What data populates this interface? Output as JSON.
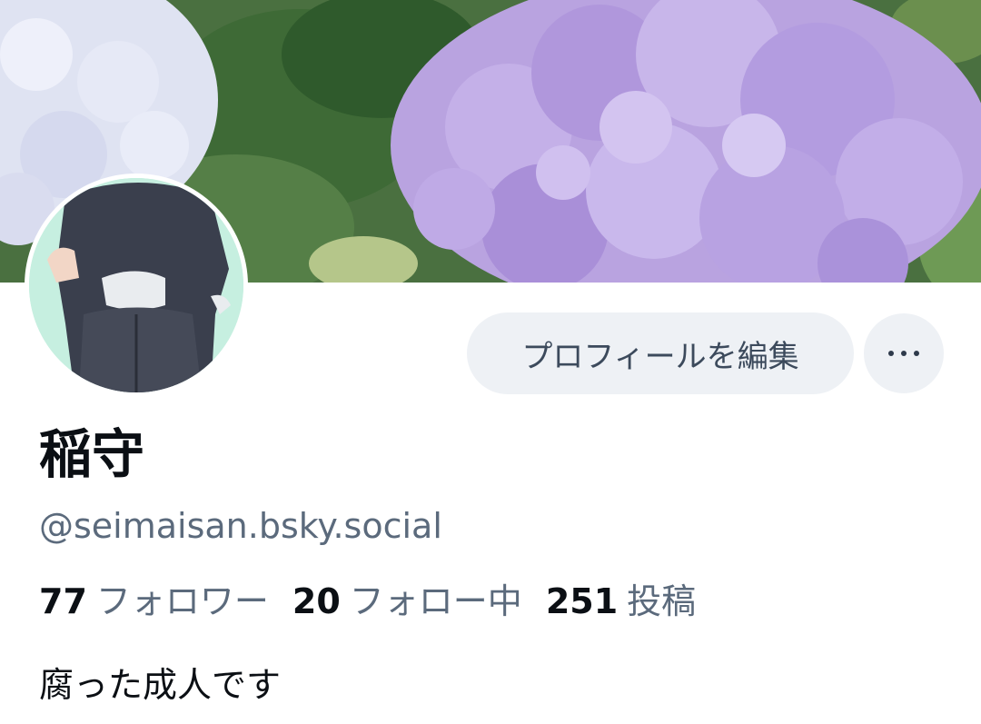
{
  "profile": {
    "banner_label": "hydrangea-banner",
    "avatar_label": "profile-avatar",
    "display_name": "稲守",
    "handle": "@seimaisan.bsky.social",
    "bio": "腐った成人です"
  },
  "actions": {
    "edit_profile_label": "プロフィールを編集",
    "more_icon": "more-horizontal-icon"
  },
  "stats": {
    "followers_count": "77",
    "followers_label": "フォロワー",
    "following_count": "20",
    "following_label": "フォロー中",
    "posts_count": "251",
    "posts_label": "投稿"
  },
  "colors": {
    "button_bg": "#eef1f5",
    "muted_text": "#5b6a7c",
    "primary_text": "#0b0f14",
    "avatar_bg": "#c6efe0"
  }
}
